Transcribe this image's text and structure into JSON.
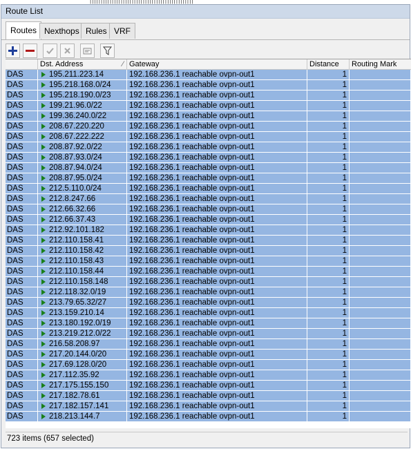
{
  "window": {
    "title": "Route List"
  },
  "tabs": [
    {
      "label": "Routes",
      "active": true
    },
    {
      "label": "Nexthops",
      "active": false
    },
    {
      "label": "Rules",
      "active": false
    },
    {
      "label": "VRF",
      "active": false
    }
  ],
  "toolbar": {
    "buttons": [
      {
        "name": "add-button",
        "icon": "plus-icon"
      },
      {
        "name": "remove-button",
        "icon": "minus-icon"
      },
      {
        "name": "enable-button",
        "icon": "check-icon"
      },
      {
        "name": "disable-button",
        "icon": "x-icon"
      },
      {
        "name": "comment-button",
        "icon": "note-icon"
      },
      {
        "name": "filter-button",
        "icon": "filter-icon"
      }
    ]
  },
  "table": {
    "columns": [
      "",
      "Dst. Address",
      "Gateway",
      "Distance",
      "Routing Mark"
    ],
    "rows": [
      {
        "flags": "DAS",
        "dst": "195.211.223.14",
        "gateway": "192.168.236.1 reachable ovpn-out1",
        "distance": "1",
        "mark": ""
      },
      {
        "flags": "DAS",
        "dst": "195.218.168.0/24",
        "gateway": "192.168.236.1 reachable ovpn-out1",
        "distance": "1",
        "mark": ""
      },
      {
        "flags": "DAS",
        "dst": "195.218.190.0/23",
        "gateway": "192.168.236.1 reachable ovpn-out1",
        "distance": "1",
        "mark": ""
      },
      {
        "flags": "DAS",
        "dst": "199.21.96.0/22",
        "gateway": "192.168.236.1 reachable ovpn-out1",
        "distance": "1",
        "mark": ""
      },
      {
        "flags": "DAS",
        "dst": "199.36.240.0/22",
        "gateway": "192.168.236.1 reachable ovpn-out1",
        "distance": "1",
        "mark": ""
      },
      {
        "flags": "DAS",
        "dst": "208.67.220.220",
        "gateway": "192.168.236.1 reachable ovpn-out1",
        "distance": "1",
        "mark": ""
      },
      {
        "flags": "DAS",
        "dst": "208.67.222.222",
        "gateway": "192.168.236.1 reachable ovpn-out1",
        "distance": "1",
        "mark": ""
      },
      {
        "flags": "DAS",
        "dst": "208.87.92.0/22",
        "gateway": "192.168.236.1 reachable ovpn-out1",
        "distance": "1",
        "mark": ""
      },
      {
        "flags": "DAS",
        "dst": "208.87.93.0/24",
        "gateway": "192.168.236.1 reachable ovpn-out1",
        "distance": "1",
        "mark": ""
      },
      {
        "flags": "DAS",
        "dst": "208.87.94.0/24",
        "gateway": "192.168.236.1 reachable ovpn-out1",
        "distance": "1",
        "mark": ""
      },
      {
        "flags": "DAS",
        "dst": "208.87.95.0/24",
        "gateway": "192.168.236.1 reachable ovpn-out1",
        "distance": "1",
        "mark": ""
      },
      {
        "flags": "DAS",
        "dst": "212.5.110.0/24",
        "gateway": "192.168.236.1 reachable ovpn-out1",
        "distance": "1",
        "mark": ""
      },
      {
        "flags": "DAS",
        "dst": "212.8.247.66",
        "gateway": "192.168.236.1 reachable ovpn-out1",
        "distance": "1",
        "mark": ""
      },
      {
        "flags": "DAS",
        "dst": "212.66.32.66",
        "gateway": "192.168.236.1 reachable ovpn-out1",
        "distance": "1",
        "mark": ""
      },
      {
        "flags": "DAS",
        "dst": "212.66.37.43",
        "gateway": "192.168.236.1 reachable ovpn-out1",
        "distance": "1",
        "mark": ""
      },
      {
        "flags": "DAS",
        "dst": "212.92.101.182",
        "gateway": "192.168.236.1 reachable ovpn-out1",
        "distance": "1",
        "mark": ""
      },
      {
        "flags": "DAS",
        "dst": "212.110.158.41",
        "gateway": "192.168.236.1 reachable ovpn-out1",
        "distance": "1",
        "mark": ""
      },
      {
        "flags": "DAS",
        "dst": "212.110.158.42",
        "gateway": "192.168.236.1 reachable ovpn-out1",
        "distance": "1",
        "mark": ""
      },
      {
        "flags": "DAS",
        "dst": "212.110.158.43",
        "gateway": "192.168.236.1 reachable ovpn-out1",
        "distance": "1",
        "mark": ""
      },
      {
        "flags": "DAS",
        "dst": "212.110.158.44",
        "gateway": "192.168.236.1 reachable ovpn-out1",
        "distance": "1",
        "mark": ""
      },
      {
        "flags": "DAS",
        "dst": "212.110.158.148",
        "gateway": "192.168.236.1 reachable ovpn-out1",
        "distance": "1",
        "mark": ""
      },
      {
        "flags": "DAS",
        "dst": "212.118.32.0/19",
        "gateway": "192.168.236.1 reachable ovpn-out1",
        "distance": "1",
        "mark": ""
      },
      {
        "flags": "DAS",
        "dst": "213.79.65.32/27",
        "gateway": "192.168.236.1 reachable ovpn-out1",
        "distance": "1",
        "mark": ""
      },
      {
        "flags": "DAS",
        "dst": "213.159.210.14",
        "gateway": "192.168.236.1 reachable ovpn-out1",
        "distance": "1",
        "mark": ""
      },
      {
        "flags": "DAS",
        "dst": "213.180.192.0/19",
        "gateway": "192.168.236.1 reachable ovpn-out1",
        "distance": "1",
        "mark": ""
      },
      {
        "flags": "DAS",
        "dst": "213.219.212.0/22",
        "gateway": "192.168.236.1 reachable ovpn-out1",
        "distance": "1",
        "mark": ""
      },
      {
        "flags": "DAS",
        "dst": "216.58.208.97",
        "gateway": "192.168.236.1 reachable ovpn-out1",
        "distance": "1",
        "mark": ""
      },
      {
        "flags": "DAS",
        "dst": "217.20.144.0/20",
        "gateway": "192.168.236.1 reachable ovpn-out1",
        "distance": "1",
        "mark": ""
      },
      {
        "flags": "DAS",
        "dst": "217.69.128.0/20",
        "gateway": "192.168.236.1 reachable ovpn-out1",
        "distance": "1",
        "mark": ""
      },
      {
        "flags": "DAS",
        "dst": "217.112.35.92",
        "gateway": "192.168.236.1 reachable ovpn-out1",
        "distance": "1",
        "mark": ""
      },
      {
        "flags": "DAS",
        "dst": "217.175.155.150",
        "gateway": "192.168.236.1 reachable ovpn-out1",
        "distance": "1",
        "mark": ""
      },
      {
        "flags": "DAS",
        "dst": "217.182.78.61",
        "gateway": "192.168.236.1 reachable ovpn-out1",
        "distance": "1",
        "mark": ""
      },
      {
        "flags": "DAS",
        "dst": "217.182.157.141",
        "gateway": "192.168.236.1 reachable ovpn-out1",
        "distance": "1",
        "mark": ""
      },
      {
        "flags": "DAS",
        "dst": "218.213.144.7",
        "gateway": "192.168.236.1 reachable ovpn-out1",
        "distance": "1",
        "mark": ""
      }
    ]
  },
  "status": {
    "text": "723 items (657 selected)"
  },
  "colors": {
    "selected_row": "#95b6e2",
    "titlebar": "#cdd9e9",
    "add": "#1f3f9a",
    "remove": "#b01818",
    "active_flag": "#1a7f1a"
  }
}
